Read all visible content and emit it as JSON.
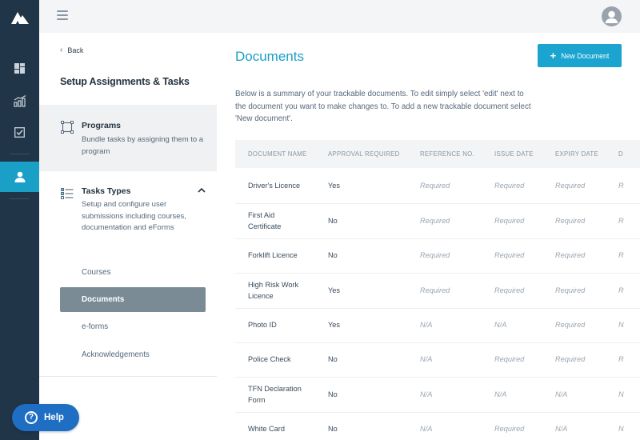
{
  "rail": {
    "logo_icon": "mountain-logo-icon",
    "items": [
      {
        "icon": "dashboard-icon"
      },
      {
        "icon": "analytics-icon"
      },
      {
        "icon": "tasks-check-icon"
      },
      {
        "icon": "user-icon",
        "active": true
      }
    ]
  },
  "topbar": {
    "menu_icon": "hamburger-icon",
    "avatar_icon": "user-avatar-icon"
  },
  "subnav": {
    "back_label": "Back",
    "title": "Setup Assignments & Tasks",
    "programs": {
      "title": "Programs",
      "description": "Bundle tasks by assigning them to a program"
    },
    "tasks_types": {
      "title": "Tasks Types",
      "description": "Setup and configure user submissions including courses, documentation and eForms",
      "items": [
        {
          "label": "Courses",
          "active": false
        },
        {
          "label": "Documents",
          "active": true
        },
        {
          "label": "e-forms",
          "active": false
        },
        {
          "label": "Acknowledgements",
          "active": false
        }
      ]
    }
  },
  "main": {
    "title": "Documents",
    "new_button_label": "New Document",
    "intro": "Below is a summary of your trackable documents. To edit simply select 'edit' next to the document you want to make changes to. To add a new trackable document select 'New document'.",
    "columns": [
      "DOCUMENT NAME",
      "APPROVAL REQUIRED",
      "REFERENCE NO.",
      "ISSUE DATE",
      "EXPIRY DATE",
      "D"
    ],
    "rows": [
      {
        "name": "Driver's Licence",
        "approval": "Yes",
        "reference": "Required",
        "issue": "Required",
        "expiry": "Required",
        "extra": "R"
      },
      {
        "name": "First Aid Certificate",
        "approval": "No",
        "reference": "Required",
        "issue": "Required",
        "expiry": "Required",
        "extra": "R"
      },
      {
        "name": "Forklift Licence",
        "approval": "No",
        "reference": "Required",
        "issue": "Required",
        "expiry": "Required",
        "extra": "R"
      },
      {
        "name": "High Risk Work Licence",
        "approval": "Yes",
        "reference": "Required",
        "issue": "Required",
        "expiry": "Required",
        "extra": "R"
      },
      {
        "name": "Photo ID",
        "approval": "Yes",
        "reference": "N/A",
        "issue": "N/A",
        "expiry": "Required",
        "extra": "N"
      },
      {
        "name": "Police Check",
        "approval": "No",
        "reference": "N/A",
        "issue": "Required",
        "expiry": "Required",
        "extra": "R"
      },
      {
        "name": "TFN Declaration Form",
        "approval": "No",
        "reference": "N/A",
        "issue": "N/A",
        "expiry": "N/A",
        "extra": "N"
      },
      {
        "name": "White Card",
        "approval": "No",
        "reference": "N/A",
        "issue": "Required",
        "expiry": "N/A",
        "extra": "N"
      }
    ]
  },
  "help": {
    "label": "Help"
  },
  "colors": {
    "rail_bg": "#213548",
    "accent": "#1a9fc7",
    "active_item_bg": "#7b8b96",
    "help_bg": "#1e6ec4"
  }
}
